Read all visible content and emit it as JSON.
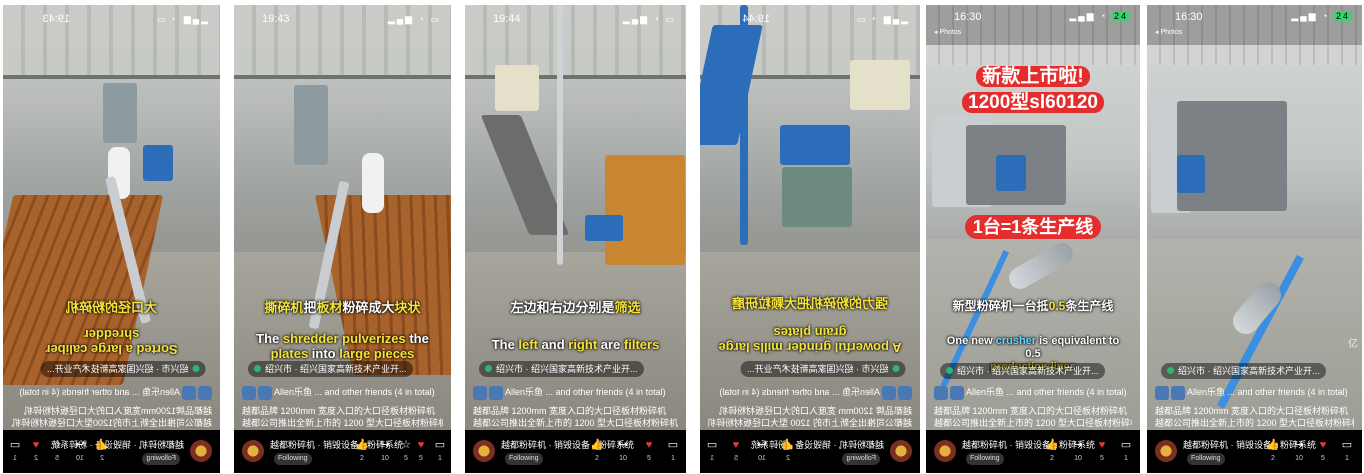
{
  "screens": [
    {
      "time": "19:43",
      "caption_cn_mirrored": "大口径的粉碎机",
      "caption_en_mirrored_lines": [
        "Sorted a large caliber",
        "shredder"
      ],
      "location": "绍兴市 · 绍兴国家高新技术产业开...",
      "friends": "Allen乐鱼 ... and other friends (4 in total)",
      "desc_lines": [
        "越都品牌1200mm宽度入口的大口径板材粉碎机",
        "越都公司推出全新上市的1200型大口径板材粉碎机..."
      ],
      "account_name": "越都粉碎机 · 销毁设备 · 粉碎系统",
      "follow_label": "Following",
      "actions": [
        {
          "icon": "comment-icon",
          "count": "2"
        },
        {
          "icon": "heart-icon",
          "count": "2"
        },
        {
          "icon": "share-icon",
          "count": "10"
        },
        {
          "icon": "star-icon",
          "count": "5"
        },
        {
          "icon": "more-icon",
          "count": "1"
        }
      ]
    },
    {
      "time": "19:43",
      "caption_cn_parts": [
        "撕碎机",
        "把",
        "板材",
        "粉碎成大",
        "块状"
      ],
      "caption_en_parts": [
        "The ",
        "shredder pulverizes",
        " the",
        "plates",
        " into ",
        "large pieces"
      ],
      "location": "绍兴市 · 绍兴国家高新技术产业开...",
      "friends": "Allen乐鱼 ... and other friends (4 in total)",
      "desc_lines": [
        "越都品牌 1200mm 宽度入口的大口径板材粉碎机",
        "越都公司推出全新上市的 1200 型大口径板材粉碎机..."
      ],
      "account_name": "越都粉碎机 · 销毁设备 · 粉碎系统",
      "follow_label": "Following",
      "actions": [
        {
          "icon": "like-icon",
          "count": "2"
        },
        {
          "icon": "share-icon",
          "count": "10"
        },
        {
          "icon": "star-icon",
          "count": "5"
        },
        {
          "icon": "heart-icon",
          "count": "5"
        },
        {
          "icon": "comment-icon",
          "count": "1"
        }
      ]
    },
    {
      "time": "19:44",
      "caption_cn_parts": [
        "左边和右边分别是",
        "筛选"
      ],
      "caption_en_parts": [
        "The ",
        "left",
        " and ",
        "right",
        " are ",
        "filters"
      ],
      "location": "绍兴市 · 绍兴国家高新技术产业开...",
      "friends": "Allen乐鱼 ... and other friends (4 in total)",
      "desc_lines": [
        "越都品牌 1200mm 宽度入口的大口径板材粉碎机",
        "越都公司推出全新上市的 1200 型大口径板材粉碎机..."
      ],
      "account_name": "越都粉碎机 · 销毁设备 · 粉碎系统",
      "follow_label": "Following",
      "actions": [
        {
          "icon": "like-icon",
          "count": "2"
        },
        {
          "icon": "share-icon",
          "count": "10"
        },
        {
          "icon": "heart-icon",
          "count": "5"
        },
        {
          "icon": "comment-icon",
          "count": "1"
        }
      ]
    },
    {
      "time": "19:44",
      "caption_cn_mirrored": "强力的粉碎机把大颗粒研磨",
      "caption_en_mirrored_lines": [
        "A powerful grinder mills large",
        "grain plates"
      ],
      "location": "绍兴市 · 绍兴国家高新技术产业开...",
      "friends": "Allen乐鱼 ... and other friends (4 in total)",
      "desc_lines": [
        "越都品牌 1200mm 宽度入口的大口径板材粉碎机",
        "越都公司推出全新上市的 1200 型大口径板材粉碎机..."
      ],
      "account_name": "越都粉碎机 · 销毁设备 · 粉碎系统",
      "follow_label": "Following",
      "actions": [
        {
          "icon": "comment-icon",
          "count": "1"
        },
        {
          "icon": "heart-icon",
          "count": "5"
        },
        {
          "icon": "share-icon",
          "count": "10"
        },
        {
          "icon": "like-icon",
          "count": "2"
        }
      ]
    },
    {
      "time": "16:30",
      "back_label": "◂ Photos",
      "battery": "24",
      "banner_lines": [
        "新款上市啦!",
        "1200型sl60120"
      ],
      "banner2": "1台=1条生产线",
      "caption_cn_parts": [
        "新型粉碎机一台抵",
        "0.5",
        "条生产线"
      ],
      "caption_en_parts": [
        "One new ",
        "crusher",
        " is equivalent to 0.5 ",
        "production line",
        "s"
      ],
      "location": "绍兴市 · 绍兴国家高新技术产业开...",
      "friends": "Allen乐鱼 ... and other friends (4 in total)",
      "desc_lines": [
        "越都品牌 1200mm 宽度入口的大口径板材粉碎机",
        "越都公司推出全新上市的 1200 型大口径板材粉碎机, 专..."
      ],
      "account_name": "越都粉碎机 · 销毁设备 · 粉碎系统",
      "follow_label": "Following",
      "actions": [
        {
          "icon": "like-icon",
          "count": "2"
        },
        {
          "icon": "share-icon",
          "count": "10"
        },
        {
          "icon": "heart-icon",
          "count": "5"
        },
        {
          "icon": "comment-icon",
          "count": "1"
        }
      ]
    },
    {
      "time": "16:30",
      "back_label": "◂ Photos",
      "battery": "24",
      "watermark": "亿",
      "location": "绍兴市 · 绍兴国家高新技术产业开...",
      "friends": "Allen乐鱼 ... and other friends (4 in total)",
      "desc_lines": [
        "越都品牌 1200mm 宽度入口的大口径板材粉碎机",
        "越都公司推出全新上市的 1200 型大口径板材粉碎机, 专..."
      ],
      "account_name": "越都粉碎机 · 销毁设备 · 粉碎系统",
      "follow_label": "Following",
      "actions": [
        {
          "icon": "like-icon",
          "count": "2"
        },
        {
          "icon": "share-icon",
          "count": "10"
        },
        {
          "icon": "heart-icon",
          "count": "5"
        },
        {
          "icon": "comment-icon",
          "count": "1"
        }
      ]
    }
  ],
  "colors": {
    "like_red": "#e4393c",
    "caption_yellow": "#f4e33a",
    "banner_red": "#e42d2d",
    "lane_blue": "#3a8fe0"
  }
}
